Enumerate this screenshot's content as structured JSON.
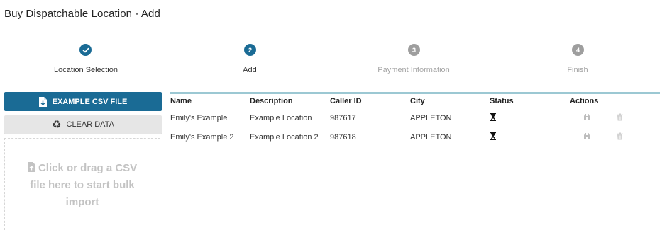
{
  "page": {
    "title": "Buy Dispatchable Location - Add"
  },
  "stepper": {
    "steps": [
      {
        "number": "1",
        "label": "Location Selection",
        "state": "done"
      },
      {
        "number": "2",
        "label": "Add",
        "state": "active"
      },
      {
        "number": "3",
        "label": "Payment Information",
        "state": "todo"
      },
      {
        "number": "4",
        "label": "Finish",
        "state": "todo"
      }
    ]
  },
  "left_panel": {
    "example_csv_label": "EXAMPLE CSV FILE",
    "clear_data_label": "CLEAR DATA",
    "dropzone_lines": [
      "Click or drag a CSV",
      "file here to start bulk",
      "import"
    ]
  },
  "table": {
    "columns": [
      "Name",
      "Description",
      "Caller ID",
      "City",
      "Status",
      "Actions"
    ],
    "rows": [
      {
        "name": "Emily's Example",
        "description": "Example Location",
        "caller_id": "987617",
        "city": "APPLETON",
        "status": "pending-hourglass-icon"
      },
      {
        "name": "Emily's Example 2",
        "description": "Example Location 2",
        "caller_id": "987618",
        "city": "APPLETON",
        "status": "pending-hourglass-icon"
      }
    ]
  },
  "colors": {
    "primary": "#1a6b95",
    "step_inactive": "#9e9e9e",
    "table_accent": "#9cc8d3",
    "secondary_button": "#e6e6e6"
  }
}
